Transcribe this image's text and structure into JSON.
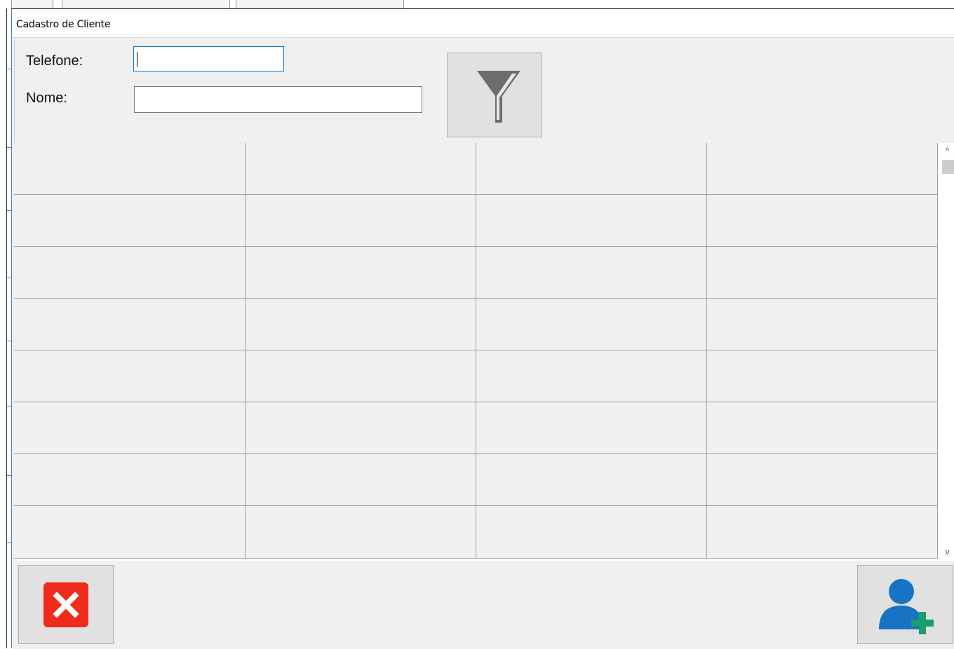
{
  "window": {
    "title": "Cadastro de Cliente"
  },
  "filters": {
    "telefone_label": "Telefone:",
    "telefone_value": "",
    "nome_label": "Nome:",
    "nome_value": ""
  },
  "buttons": {
    "filter_icon": "funnel-icon",
    "close_icon": "close-x-icon",
    "add_client_icon": "user-add-icon"
  },
  "grid": {
    "columns": 4,
    "rows": [
      [
        "",
        "",
        "",
        ""
      ],
      [
        "",
        "",
        "",
        ""
      ],
      [
        "",
        "",
        "",
        ""
      ],
      [
        "",
        "",
        "",
        ""
      ],
      [
        "",
        "",
        "",
        ""
      ],
      [
        "",
        "",
        "",
        ""
      ],
      [
        "",
        "",
        "",
        ""
      ],
      [
        "",
        "",
        "",
        ""
      ]
    ]
  },
  "scrollbar": {
    "up_arrow": "^",
    "down_arrow": "v"
  },
  "colors": {
    "close_red": "#f02b1c",
    "user_blue": "#1673c5",
    "plus_green": "#1a9e6e",
    "funnel_gray": "#6d6d6d",
    "focus_blue": "#0078d7"
  }
}
